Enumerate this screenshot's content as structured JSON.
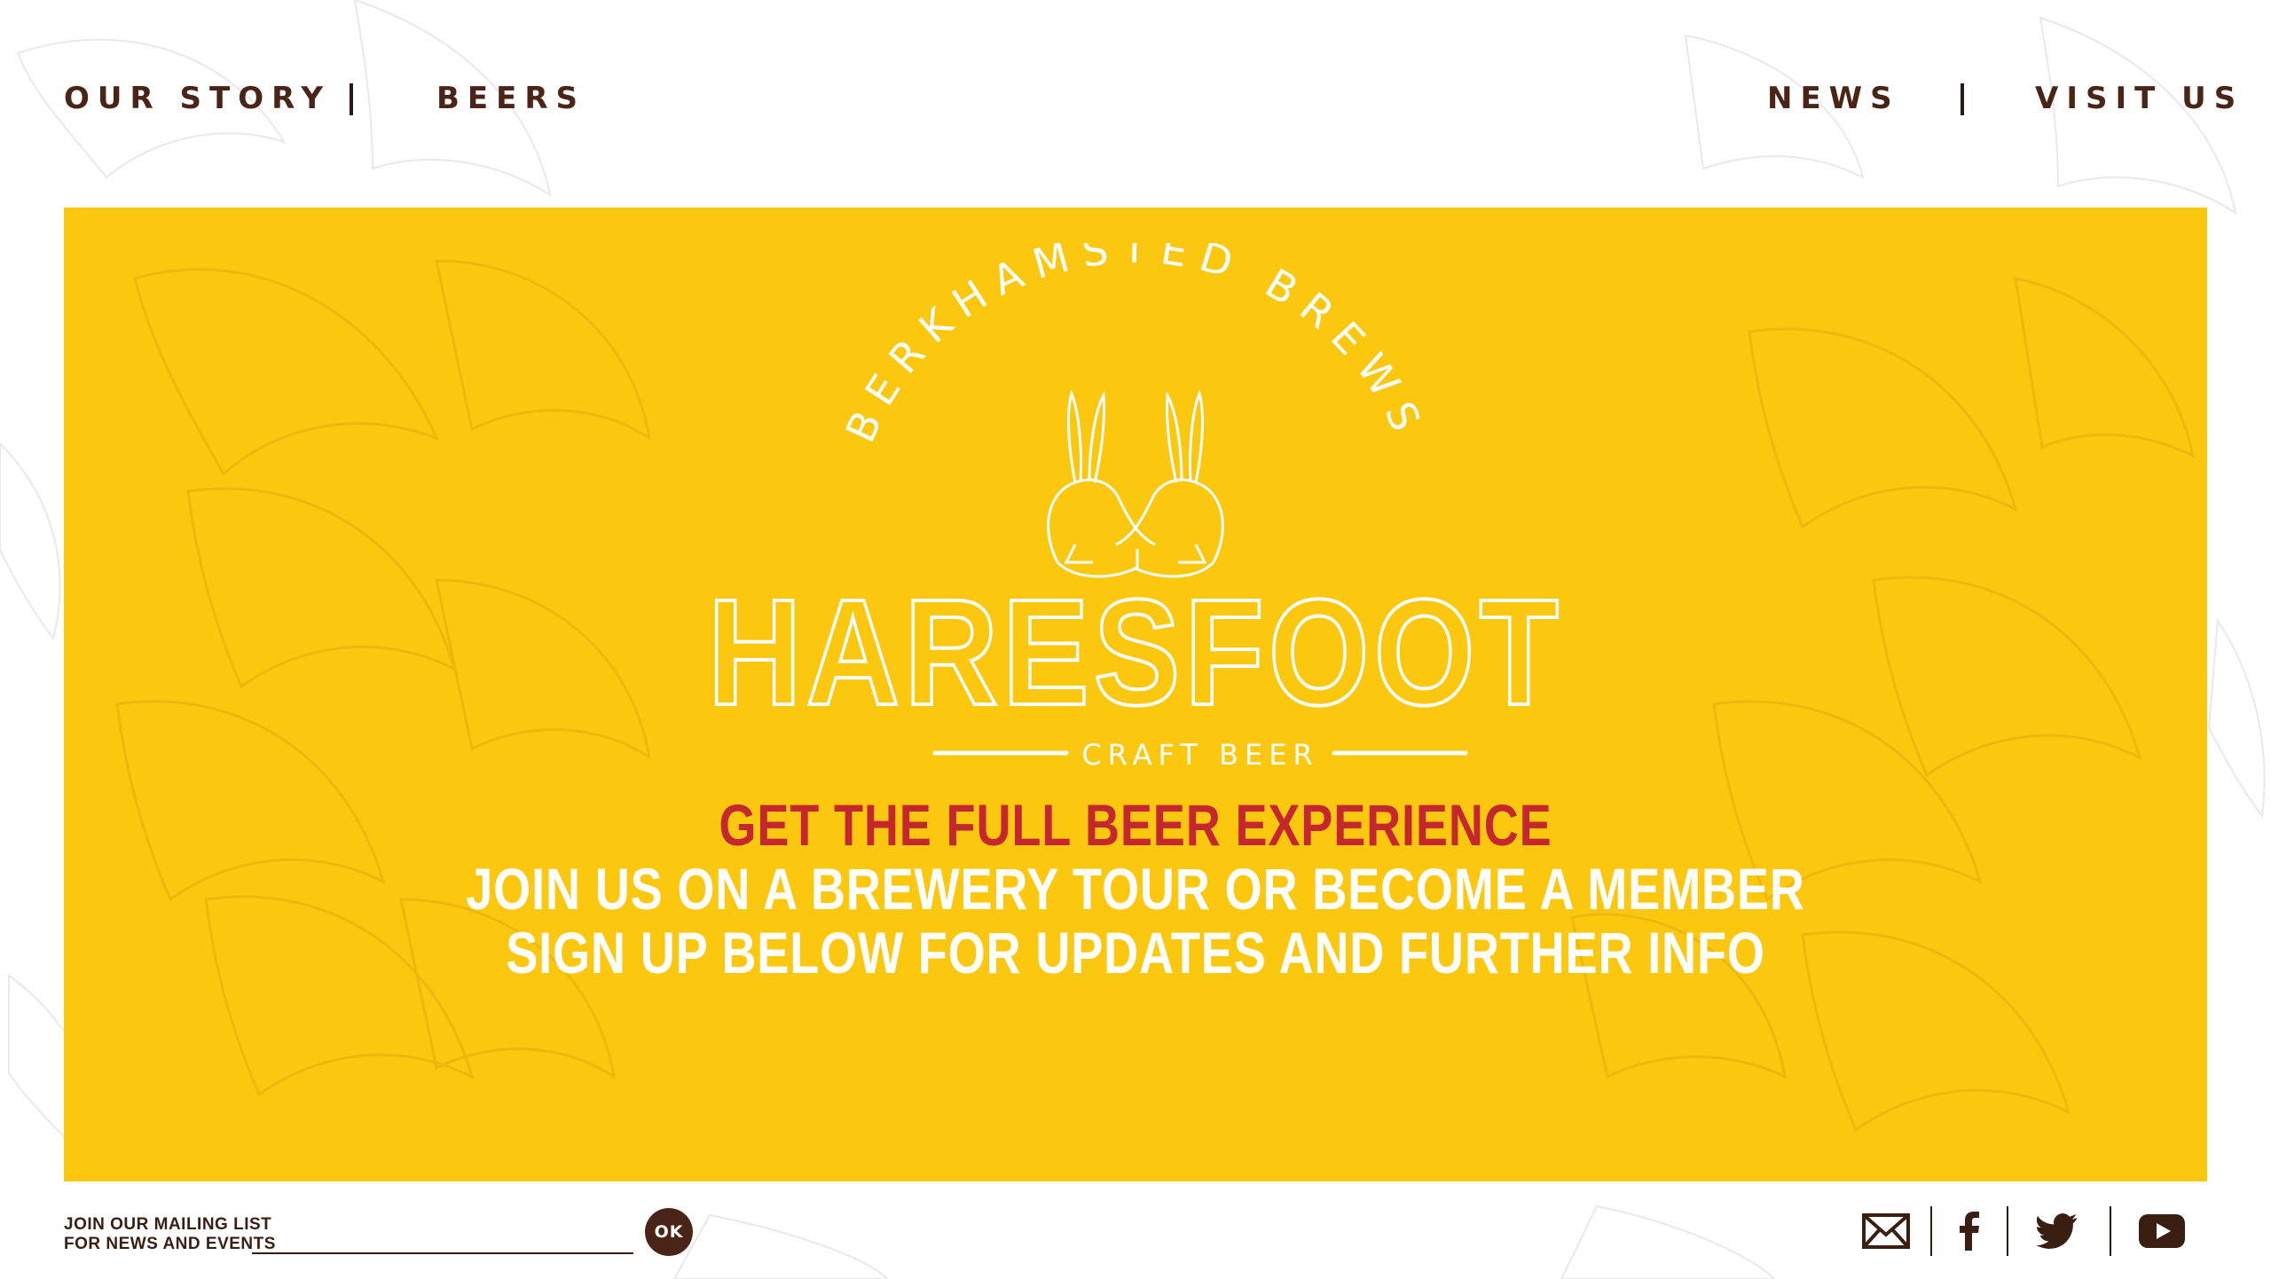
{
  "nav": {
    "left": [
      "OUR STORY",
      "BEERS"
    ],
    "right": [
      "NEWS",
      "VISIT US"
    ]
  },
  "logo": {
    "arc_text": "BERKHAMSTED BREWS",
    "brand": "HARESFOOT",
    "subtitle": "CRAFT BEER"
  },
  "hero": {
    "headline": "GET THE FULL BEER EXPERIENCE",
    "line2": "JOIN US ON A BREWERY TOUR OR BECOME A MEMBER",
    "line3": "SIGN UP BELOW FOR UPDATES AND FURTHER INFO"
  },
  "mailing": {
    "label_line1": "JOIN OUR MAILING LIST",
    "label_line2": "FOR NEWS AND EVENTS",
    "input_value": "",
    "submit_label": "OK"
  },
  "social": {
    "icons": [
      "email-icon",
      "facebook-icon",
      "twitter-icon",
      "youtube-icon"
    ]
  },
  "colors": {
    "hero_bg": "#fcc70f",
    "brand_brown": "#4a2416",
    "headline_red": "#c4282e",
    "white": "#ffffff"
  }
}
